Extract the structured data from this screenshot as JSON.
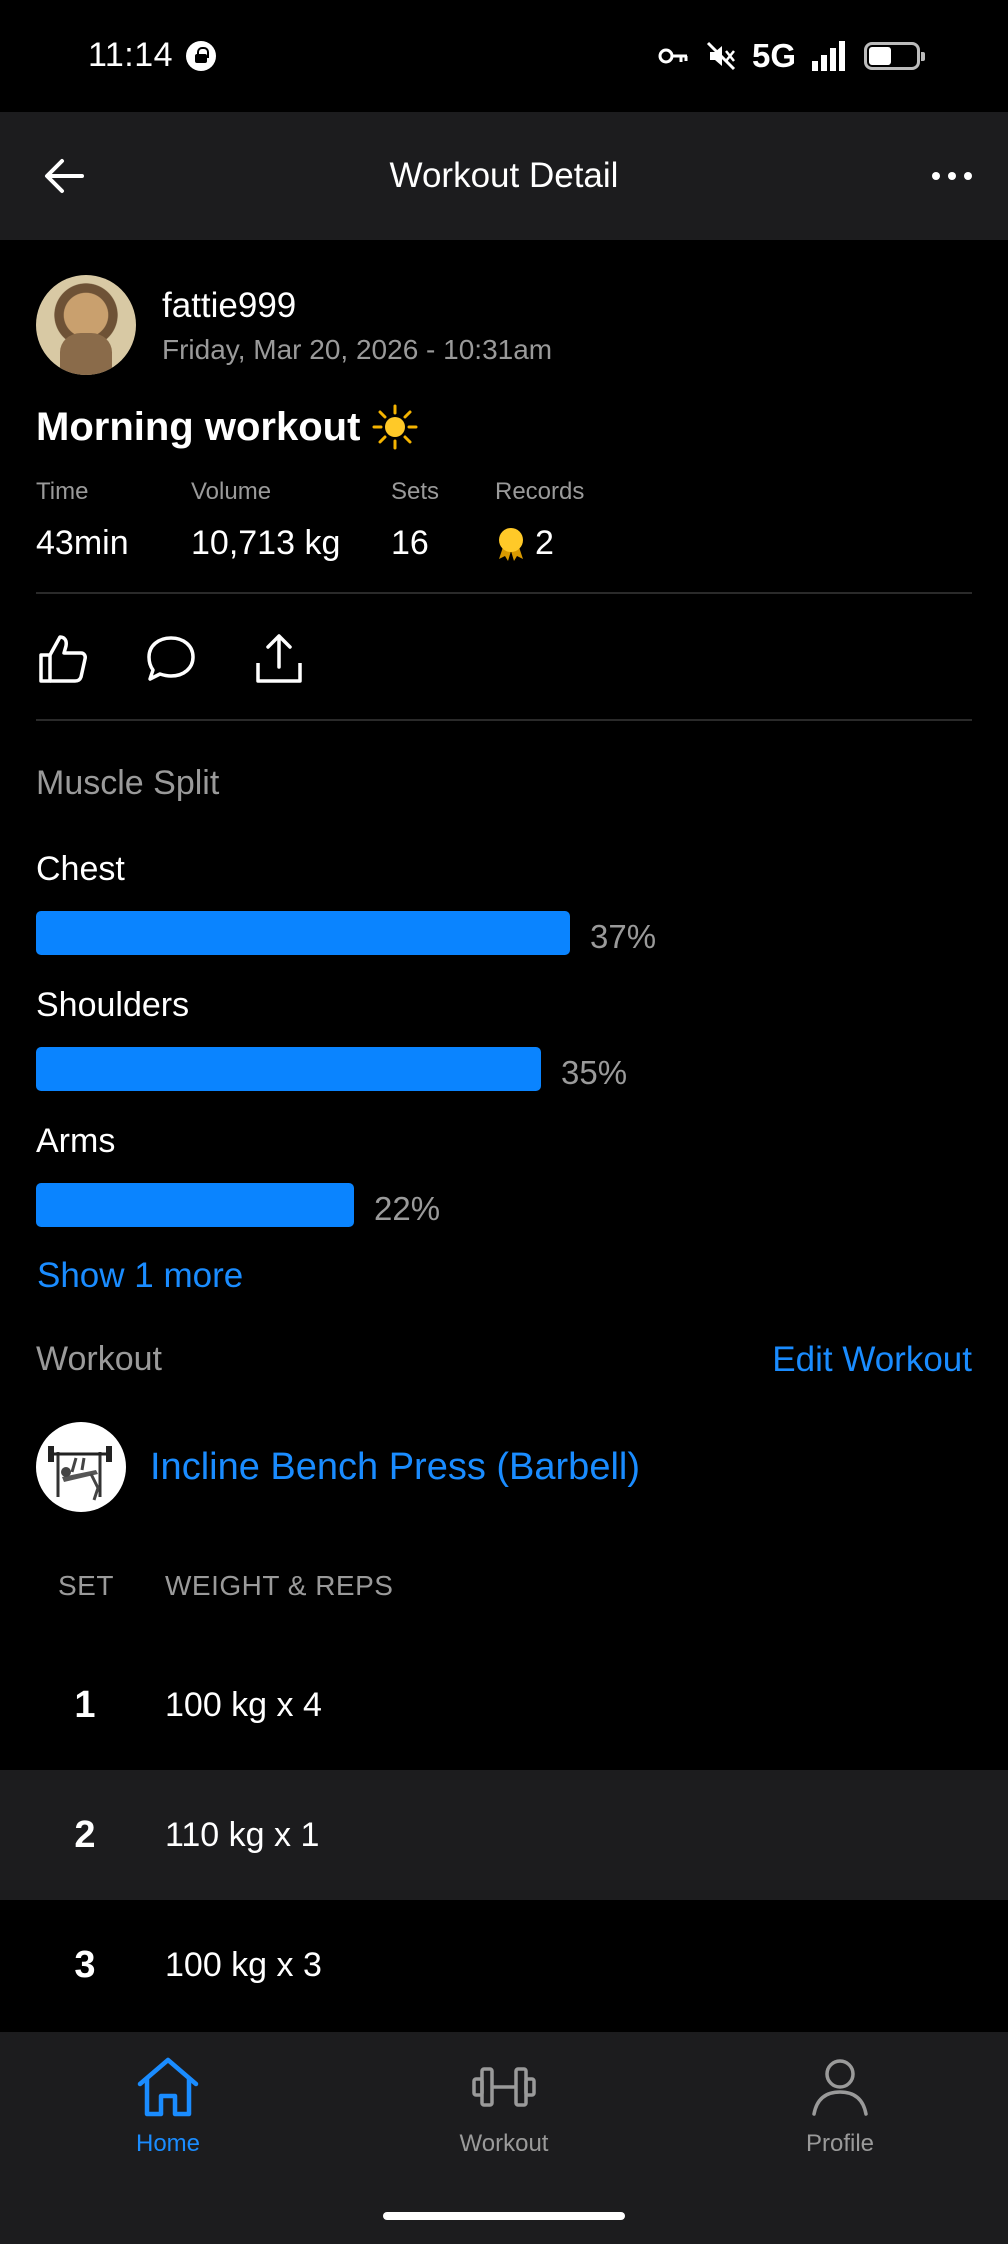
{
  "status_bar": {
    "time": "11:14",
    "network": "5G"
  },
  "header": {
    "title": "Workout Detail"
  },
  "post": {
    "username": "fattie999",
    "datetime": "Friday, Mar 20, 2026 - 10:31am",
    "title": "Morning workout",
    "title_emoji": "sun-icon"
  },
  "stats": {
    "time_label": "Time",
    "time_value": "43min",
    "volume_label": "Volume",
    "volume_value": "10,713 kg",
    "sets_label": "Sets",
    "sets_value": "16",
    "records_label": "Records",
    "records_value": "2"
  },
  "muscle_split": {
    "label": "Muscle Split",
    "items": [
      {
        "name": "Chest",
        "percent_text": "37%",
        "percent": 37
      },
      {
        "name": "Shoulders",
        "percent_text": "35%",
        "percent": 35
      },
      {
        "name": "Arms",
        "percent_text": "22%",
        "percent": 22
      }
    ],
    "show_more": "Show 1 more",
    "bar_color": "#0a84ff"
  },
  "workout": {
    "label": "Workout",
    "edit_label": "Edit Workout",
    "exercise_name": "Incline Bench Press (Barbell)",
    "set_col": "SET",
    "weight_col": "WEIGHT & REPS",
    "sets": [
      {
        "num": "1",
        "value": "100 kg x 4"
      },
      {
        "num": "2",
        "value": "110 kg x 1"
      },
      {
        "num": "3",
        "value": "100 kg x 3"
      }
    ]
  },
  "nav": {
    "home": "Home",
    "workout": "Workout",
    "profile": "Profile",
    "active_color": "#1a8cff",
    "inactive_color": "#9a9a9a"
  }
}
